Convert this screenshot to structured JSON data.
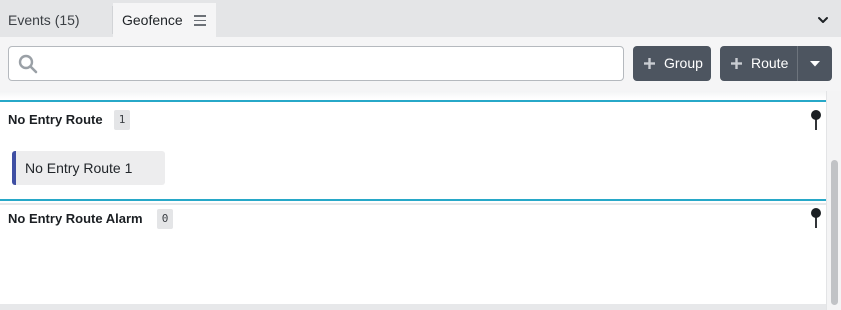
{
  "tabs": [
    {
      "label": "Events (15)",
      "active": false
    },
    {
      "label": "Geofence",
      "active": true
    }
  ],
  "tab_icons": {
    "geofence_menu": "hamburger-menu-icon",
    "collapse": "chevron-down-icon"
  },
  "search": {
    "value": "",
    "placeholder": "",
    "icon": "search-icon"
  },
  "toolbar": {
    "group_button_label": "Group",
    "route_button_label": "Route",
    "add_icon": "plus-icon",
    "dropdown_icon": "caret-down-icon"
  },
  "sections": [
    {
      "title": "No Entry Route",
      "count": "1",
      "icon": "map-pin-icon",
      "items": [
        {
          "label": "No Entry Route 1"
        }
      ]
    },
    {
      "title": "No Entry Route Alarm",
      "count": "0",
      "icon": "map-pin-icon",
      "items": []
    }
  ],
  "colors": {
    "accent": "#27a8c8",
    "button": "#4d5560",
    "chip_border": "#3f4fa3",
    "tabbar": "#e4e5e7"
  }
}
